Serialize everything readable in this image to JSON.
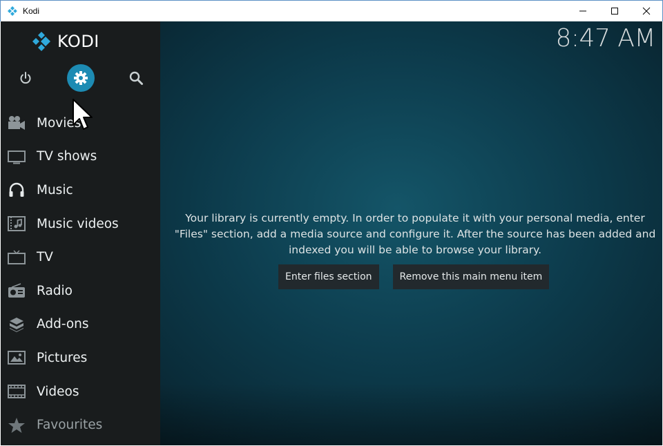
{
  "window": {
    "title": "Kodi",
    "controls": [
      "minimize-icon",
      "maximize-icon",
      "close-icon"
    ]
  },
  "logo": {
    "text": "KODI",
    "icon": "kodi-logo-icon",
    "color": "#2fa9dc"
  },
  "top_buttons": [
    {
      "name": "power",
      "icon": "power-icon"
    },
    {
      "name": "settings",
      "icon": "gear-icon",
      "selected": true,
      "color": "#1d8bb3"
    },
    {
      "name": "search",
      "icon": "search-icon"
    }
  ],
  "menu": {
    "items": [
      {
        "label": "Movies",
        "icon": "movie-camera-icon"
      },
      {
        "label": "TV shows",
        "icon": "monitor-icon"
      },
      {
        "label": "Music",
        "icon": "headphones-icon"
      },
      {
        "label": "Music videos",
        "icon": "music-video-icon"
      },
      {
        "label": "TV",
        "icon": "tv-icon"
      },
      {
        "label": "Radio",
        "icon": "radio-icon"
      },
      {
        "label": "Add-ons",
        "icon": "addons-box-icon"
      },
      {
        "label": "Pictures",
        "icon": "picture-icon"
      },
      {
        "label": "Videos",
        "icon": "film-strip-icon"
      },
      {
        "label": "Favourites",
        "icon": "star-icon"
      }
    ]
  },
  "clock": "8:47 AM",
  "main": {
    "message": "Your library is currently empty. In order to populate it with your personal media, enter \"Files\" section, add a media source and configure it. After the source has been added and indexed you will be able to browse your library.",
    "buttons": {
      "enter_files": "Enter files section",
      "remove_item": "Remove this main menu item"
    }
  },
  "colors": {
    "sidebar_bg": "#191c1d",
    "accent": "#1d8bb3",
    "background": "#0d3d4e"
  }
}
